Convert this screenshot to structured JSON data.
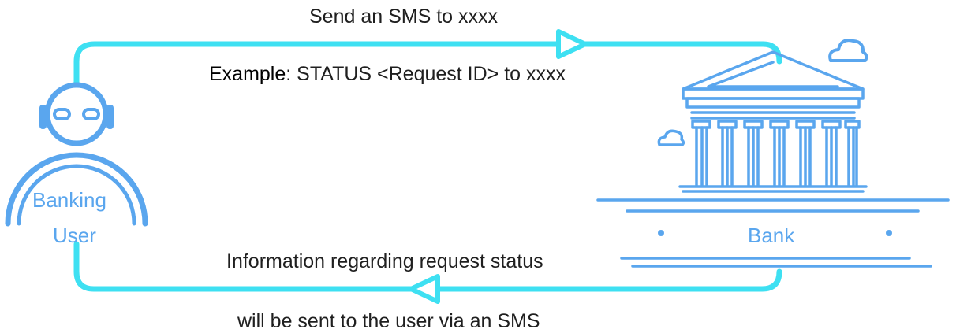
{
  "top": {
    "message": "Send an SMS to xxxx",
    "example_prefix": "Example",
    "example_text": ": STATUS <Request ID> to xxxx"
  },
  "bottom": {
    "line1": "Information regarding request status",
    "line2": "will be sent to the user via an SMS"
  },
  "user": {
    "label_line1": "Banking",
    "label_line2": "User"
  },
  "bank": {
    "label": "Bank"
  },
  "colors": {
    "flow_line": "#3ee0f2",
    "illustration": "#5aa6ee",
    "text": "#1f1f1f"
  }
}
